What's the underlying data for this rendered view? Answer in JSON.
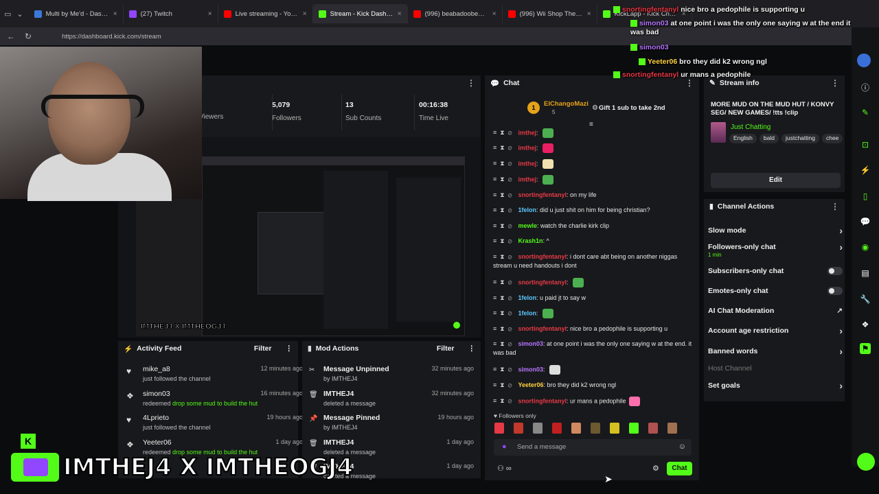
{
  "browser": {
    "tabs": [
      {
        "label": "Multi by Me'd - Dashboard",
        "color": "#3c78d8"
      },
      {
        "label": "(27) Twitch",
        "color": "#9146ff"
      },
      {
        "label": "Live streaming - YouTube St",
        "color": "#ff0000"
      },
      {
        "label": "Stream - Kick Dashboard",
        "color": "#53fc18"
      },
      {
        "label": "(996) beabadoobee - the p",
        "color": "#ff0000"
      },
      {
        "label": "(996) Wii Shop Theme - Vin",
        "color": "#ff0000"
      },
      {
        "label": "KickLapp - Kick Chatbot",
        "color": "#53fc18"
      }
    ],
    "url": "https://dashboard.kick.com/stream"
  },
  "overlay_chat": [
    {
      "user": "snortingfentanyl",
      "text": "nice bro a pedophile is supporting u",
      "color": "#e63946"
    },
    {
      "user": "simon03",
      "text": "at one point i was the only one saying w at the end it was bad",
      "color": "#b675ff"
    },
    {
      "user": "simon03",
      "text": "",
      "color": "#b675ff"
    },
    {
      "user": "Yeeter06",
      "text": "bro they did k2 wrong ngl",
      "color": "#ffd23f"
    },
    {
      "user": "snortingfentanyl",
      "text": "ur mans a pedophile",
      "color": "#e63946"
    }
  ],
  "stats": [
    {
      "value": "",
      "label": "Viewers"
    },
    {
      "value": "5,079",
      "label": "Followers"
    },
    {
      "value": "13",
      "label": "Sub Counts"
    },
    {
      "value": "00:16:38",
      "label": "Time Live"
    }
  ],
  "activity_feed": {
    "title": "Activity Feed",
    "filter": "Filter",
    "items": [
      {
        "name": "mike_a8",
        "desc": "just followed the channel",
        "highlight": "",
        "time": "12 minutes ago",
        "icon": "heart-icon"
      },
      {
        "name": "simon03",
        "desc": "redeemed",
        "highlight": "drop some mud to build the hut",
        "time": "16 minutes ago",
        "icon": "reward-icon"
      },
      {
        "name": "4Lprieto",
        "desc": "just followed the channel",
        "highlight": "",
        "time": "19 hours ago",
        "icon": "heart-icon"
      },
      {
        "name": "Yeeter06",
        "desc": "redeemed",
        "highlight": "drop some mud to build the hut",
        "time": "1 day ago",
        "icon": "reward-icon"
      }
    ]
  },
  "mod_actions": {
    "title": "Mod Actions",
    "filter": "Filter",
    "items": [
      {
        "name": "Message Unpinned",
        "desc": "by IMTHEJ4",
        "time": "32 minutes ago",
        "icon": "unpin-icon"
      },
      {
        "name": "IMTHEJ4",
        "desc": "deleted a message",
        "time": "32 minutes ago",
        "icon": "trash-icon"
      },
      {
        "name": "Message Pinned",
        "desc": "by IMTHEJ4",
        "time": "19 hours ago",
        "icon": "pin-icon"
      },
      {
        "name": "IMTHEJ4",
        "desc": "deleted a message",
        "time": "1 day ago",
        "icon": "trash-icon"
      },
      {
        "name": "IMTHEJ4",
        "desc": "deleted a message",
        "time": "1 day ago",
        "icon": "trash-icon"
      }
    ]
  },
  "chat": {
    "title": "Chat",
    "pinned_user": "ElChangoMazi",
    "pinned_count": "5",
    "gift_text": "Gift 1 sub to take 2nd",
    "messages": [
      {
        "user": "imthej",
        "color": "red",
        "text": "",
        "emote": "#4caf50"
      },
      {
        "user": "imthej",
        "color": "red",
        "text": "",
        "emote": "#e91e63"
      },
      {
        "user": "imthej",
        "color": "red",
        "text": "",
        "emote": "#f0e0b0"
      },
      {
        "user": "imthej",
        "color": "red",
        "text": "",
        "emote": "#4caf50"
      },
      {
        "user": "snortingfentanyl",
        "color": "red",
        "text": "on my life",
        "emote": ""
      },
      {
        "user": "1felon",
        "color": "blue",
        "text": "did u just shit on him for being christian?",
        "emote": ""
      },
      {
        "user": "mewle",
        "color": "green",
        "text": "watch the charlie kirk clip",
        "emote": ""
      },
      {
        "user": "Krash1n",
        "color": "green",
        "text": "^",
        "emote": ""
      },
      {
        "user": "snortingfentanyl",
        "color": "red",
        "text": "i dont care abt being on another niggas stream u need handouts i dont",
        "emote": ""
      },
      {
        "user": "snortingfentanyl",
        "color": "red",
        "text": "",
        "emote": "#4caf50"
      },
      {
        "user": "1felon",
        "color": "blue",
        "text": "u paid jt to say w",
        "emote": ""
      },
      {
        "user": "1felon",
        "color": "blue",
        "text": "",
        "emote": "#4caf50"
      },
      {
        "user": "snortingfentanyl",
        "color": "red",
        "text": "nice bro a pedophile is supporting u",
        "emote": ""
      },
      {
        "user": "simon03",
        "color": "purple",
        "text": "at one point i was the only one saying w at the end. it was bad",
        "emote": ""
      },
      {
        "user": "simon03",
        "color": "purple",
        "text": "",
        "emote": "#ddd"
      },
      {
        "user": "Yeeter06",
        "color": "yellow",
        "text": "bro they did k2 wrong ngl",
        "emote": ""
      },
      {
        "user": "snortingfentanyl",
        "color": "red",
        "text": "ur mans a pedophile",
        "emote": "#ff6fae"
      }
    ],
    "followers_only": "Followers only",
    "placeholder": "Send a message",
    "send_label": "Chat"
  },
  "stream_info": {
    "title": "Stream info",
    "stream_title": "MORE MUD ON THE MUD HUT / KONVY SEG/ NEW GAMES/ !tts !clip",
    "category": "Just Chatting",
    "tags": [
      "English",
      "bald",
      "justchatting",
      "chee"
    ],
    "edit_label": "Edit"
  },
  "channel_actions": {
    "title": "Channel Actions",
    "items": [
      {
        "label": "Slow mode",
        "sub": "",
        "control": "chevron"
      },
      {
        "label": "Followers-only chat",
        "sub": "1 min",
        "control": "chevron"
      },
      {
        "label": "Subscribers-only chat",
        "sub": "",
        "control": "toggle"
      },
      {
        "label": "Emotes-only chat",
        "sub": "",
        "control": "toggle"
      },
      {
        "label": "AI Chat Moderation",
        "sub": "",
        "control": "external"
      },
      {
        "label": "Account age restriction",
        "sub": "",
        "control": "chevron"
      },
      {
        "label": "Banned words",
        "sub": "",
        "control": "chevron"
      },
      {
        "label": "Host Channel",
        "sub": "",
        "control": "none"
      },
      {
        "label": "Set goals",
        "sub": "",
        "control": "chevron"
      }
    ]
  },
  "overlay_logo": {
    "small_text": "IMTHEJ4 X IMTHEOGJ4",
    "big_text": "IMTHEJ4 X IMTHEOGJ4"
  },
  "colors": {
    "kick_green": "#53fc18",
    "panel_bg": "#18191c",
    "page_bg": "#0b0c0e"
  }
}
